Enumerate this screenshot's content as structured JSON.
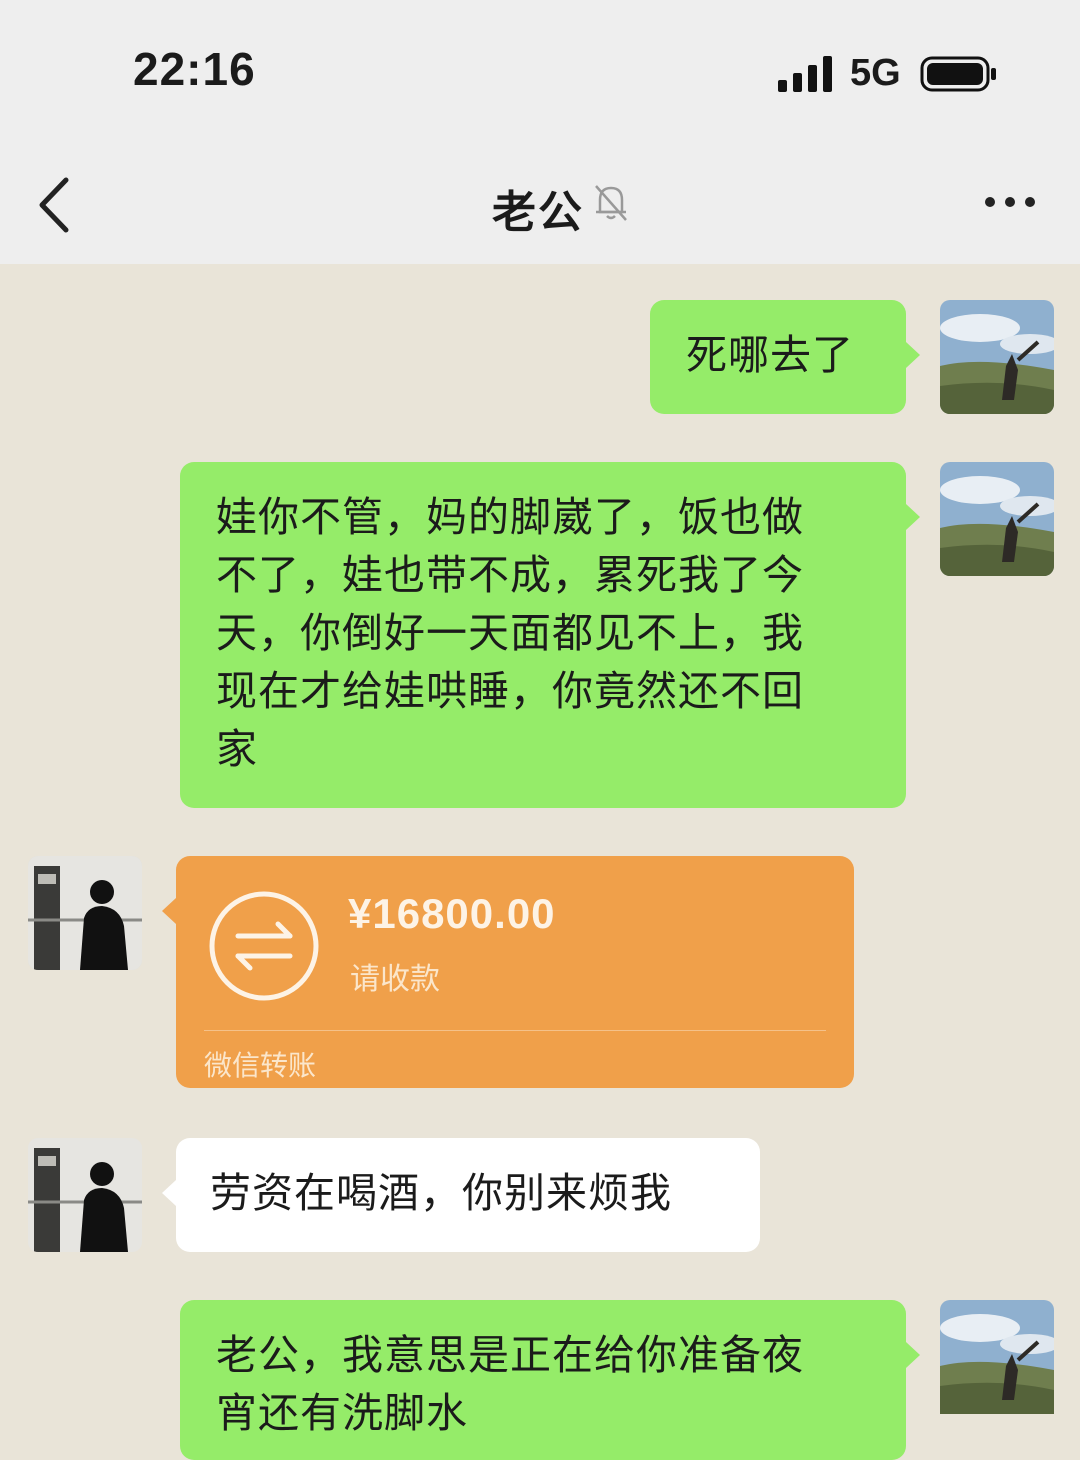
{
  "status_bar": {
    "time": "22:16",
    "network": "5G",
    "signal_icon": "signal-bars-icon",
    "battery_icon": "battery-icon"
  },
  "nav": {
    "title": "老公",
    "back_icon": "chevron-left-icon",
    "mute_icon": "bell-mute-icon",
    "more_icon": "more-dots-icon"
  },
  "messages": [
    {
      "side": "right",
      "type": "text",
      "text": "死哪去了"
    },
    {
      "side": "right",
      "type": "text",
      "text": "娃你不管，妈的脚崴了，饭也做\n不了，娃也带不成，累死我了今\n天，你倒好一天面都见不上，我\n现在才给娃哄睡，你竟然还不回\n家"
    },
    {
      "side": "left",
      "type": "transfer",
      "amount": "¥16800.00",
      "status": "请收款",
      "source": "微信转账"
    },
    {
      "side": "left",
      "type": "text",
      "text": "劳资在喝酒，你别来烦我"
    },
    {
      "side": "right",
      "type": "text",
      "text": "老公，我意思是正在给你准备夜\n宵还有洗脚水"
    }
  ],
  "colors": {
    "outgoing_bubble": "#95ec69",
    "incoming_bubble": "#ffffff",
    "transfer_card": "#f0a04a",
    "chat_background": "#e9e4d8",
    "bar_background": "#eeeeee"
  }
}
